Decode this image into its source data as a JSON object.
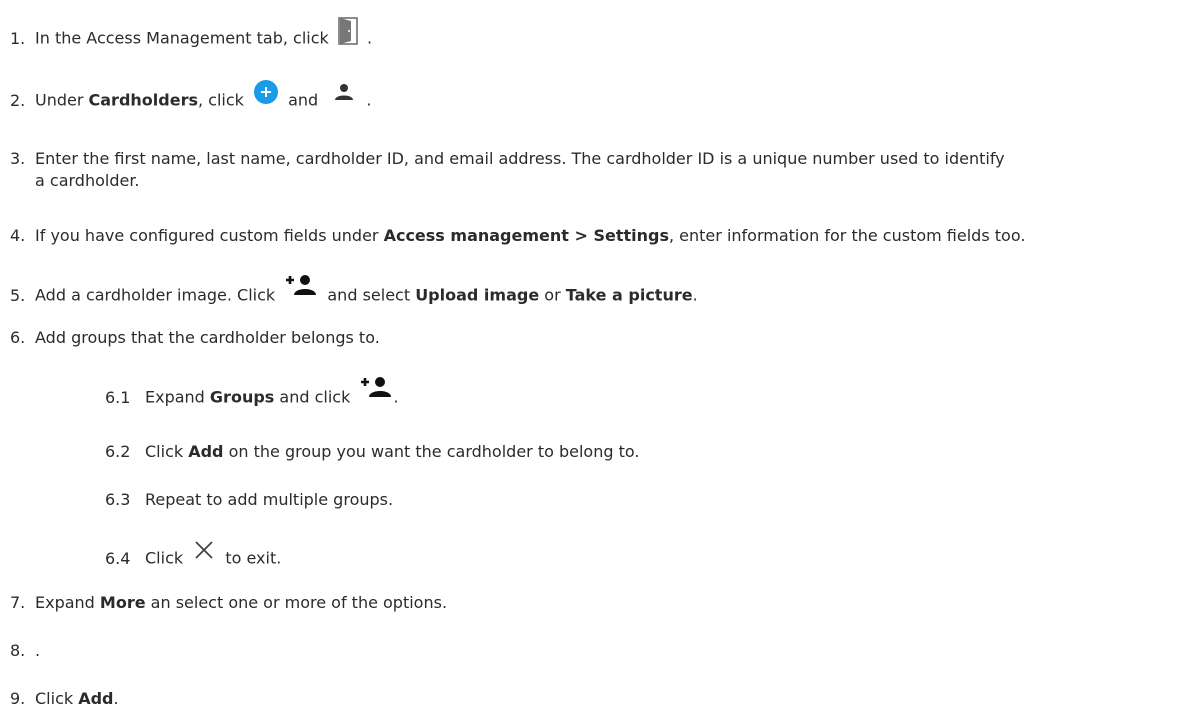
{
  "steps": {
    "s1": {
      "num": "1.",
      "t1": "In the Access Management tab, click",
      "t2": ".",
      "icon": "door-icon"
    },
    "s2": {
      "num": "2.",
      "t1": "Under ",
      "b1": "Cardholders",
      "t2": ", click",
      "t3": "and",
      "t4": ".",
      "icon1": "add-circle-icon",
      "icon2": "person-icon",
      "accent": "#1a9be6"
    },
    "s3": {
      "num": "3.",
      "line1": "Enter the first name, last name, cardholder ID, and email address. The cardholder ID is a unique number used to identify",
      "line2": "a cardholder."
    },
    "s4": {
      "num": "4.",
      "t1": "If you have configured custom fields under ",
      "b1": "Access management > Settings",
      "t2": ", enter information for the custom fields too."
    },
    "s5": {
      "num": "5.",
      "t1": "Add a cardholder image. Click",
      "t2": "and select ",
      "b1": "Upload image",
      "t3": " or ",
      "b2": "Take a picture",
      "t4": ".",
      "icon": "add-person-icon"
    },
    "s6": {
      "num": "6.",
      "t1": "Add groups that the cardholder belongs to."
    },
    "s61": {
      "num": "6.1",
      "t1": "Expand ",
      "b1": "Groups",
      "t2": " and click",
      "t3": ".",
      "icon": "add-person-icon"
    },
    "s62": {
      "num": "6.2",
      "t1": "Click ",
      "b1": "Add",
      "t2": " on the group you want the cardholder to belong to."
    },
    "s63": {
      "num": "6.3",
      "t1": "Repeat to add multiple groups."
    },
    "s64": {
      "num": "6.4",
      "t1": "Click",
      "t2": "to exit.",
      "icon": "close-icon"
    },
    "s7": {
      "num": "7.",
      "t1": "Expand ",
      "b1": "More",
      "t2": " an select one or more of the options."
    },
    "s8": {
      "num": "8.",
      "t1": "."
    },
    "s9": {
      "num": "9.",
      "t1": "Click ",
      "b1": "Add",
      "t2": "."
    }
  }
}
